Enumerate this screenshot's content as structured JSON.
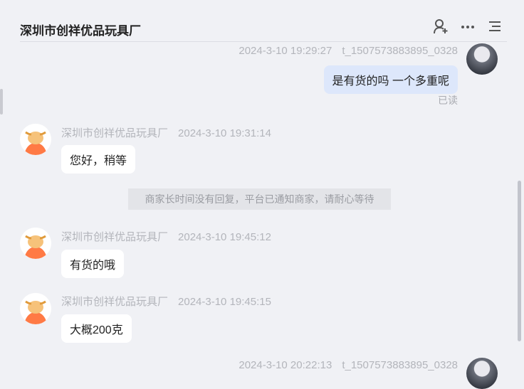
{
  "header": {
    "title": "深圳市创祥优品玩具厂",
    "icons": [
      "user-add-icon",
      "more-icon",
      "menu-icon"
    ]
  },
  "messages": [
    {
      "side": "right",
      "time": "2024-3-10 19:29:27",
      "sender": "t_1507573883895_0328",
      "text": "是有货的吗 一个多重呢",
      "status": "已读"
    },
    {
      "side": "left",
      "sender": "深圳市创祥优品玩具厂",
      "time": "2024-3-10 19:31:14",
      "text": "您好，稍等"
    },
    {
      "side": "system",
      "text": "商家长时间没有回复，平台已通知商家，请耐心等待"
    },
    {
      "side": "left",
      "sender": "深圳市创祥优品玩具厂",
      "time": "2024-3-10 19:45:12",
      "text": "有货的哦"
    },
    {
      "side": "left",
      "sender": "深圳市创祥优品玩具厂",
      "time": "2024-3-10 19:45:15",
      "text": "大概200克"
    },
    {
      "side": "right",
      "time": "2024-3-10 20:22:13",
      "sender": "t_1507573883895_0328"
    }
  ],
  "colors": {
    "background": "#f0f1f5",
    "my_bubble": "#dde7fb",
    "their_bubble": "#ffffff",
    "shop_avatar": "#ff7a45"
  }
}
